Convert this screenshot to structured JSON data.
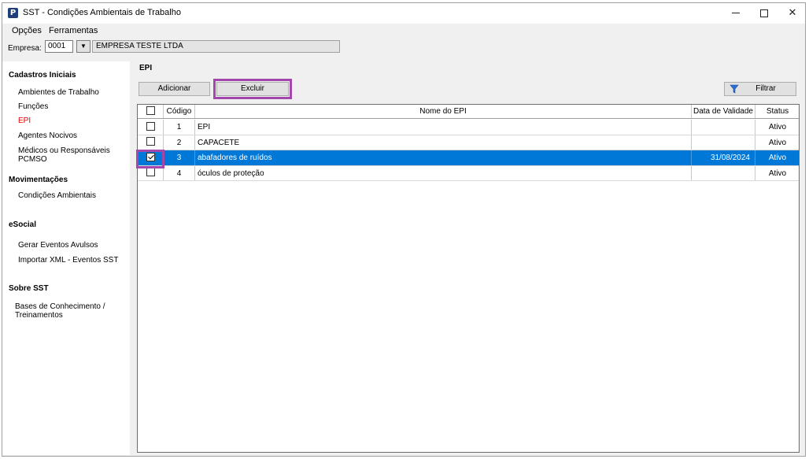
{
  "window": {
    "title": "SST - Condições Ambientais de Trabalho",
    "app_icon_letter": "P",
    "controls": {
      "minimize": "minimize-icon",
      "maximize": "maximize-icon",
      "close_glyph": "✕"
    }
  },
  "menu": {
    "items": [
      "Opções",
      "Ferramentas"
    ]
  },
  "empresa": {
    "label": "Empresa:",
    "code": "0001",
    "dropdown_glyph": "▼",
    "name": "EMPRESA TESTE LTDA"
  },
  "sidebar": {
    "sections": [
      {
        "title": "Cadastros Iniciais",
        "items": [
          "Ambientes de Trabalho",
          "Funções",
          "EPI",
          "Agentes Nocivos",
          "Médicos ou Responsáveis PCMSO"
        ]
      },
      {
        "title": "Movimentações",
        "items": [
          "Condições Ambientais"
        ]
      },
      {
        "title": "eSocial",
        "items": [
          "Gerar Eventos Avulsos",
          "Importar XML - Eventos SST"
        ]
      },
      {
        "title": "Sobre SST",
        "items": [
          "Bases de Conhecimento / Treinamentos"
        ]
      }
    ],
    "active_item": "EPI",
    "active_color": "#e00000"
  },
  "main": {
    "title": "EPI",
    "toolbar": {
      "add_label": "Adicionar",
      "delete_label": "Excluir",
      "filter_label": "Filtrar",
      "filter_icon": "funnel-icon"
    },
    "highlight_color": "#a347ad",
    "grid": {
      "columns": [
        "Código",
        "Nome do EPI",
        "Data de Validade",
        "Status"
      ],
      "rows": [
        {
          "checked": false,
          "code": "1",
          "name": "EPI",
          "date": "",
          "status": "Ativo"
        },
        {
          "checked": false,
          "code": "2",
          "name": "CAPACETE",
          "date": "",
          "status": "Ativo"
        },
        {
          "checked": true,
          "code": "3",
          "name": "abafadores de ruídos",
          "date": "31/08/2024",
          "status": "Ativo",
          "selected": true
        },
        {
          "checked": false,
          "code": "4",
          "name": "óculos de proteção",
          "date": "",
          "status": "Ativo"
        }
      ],
      "selection_color": "#0078d7"
    }
  }
}
